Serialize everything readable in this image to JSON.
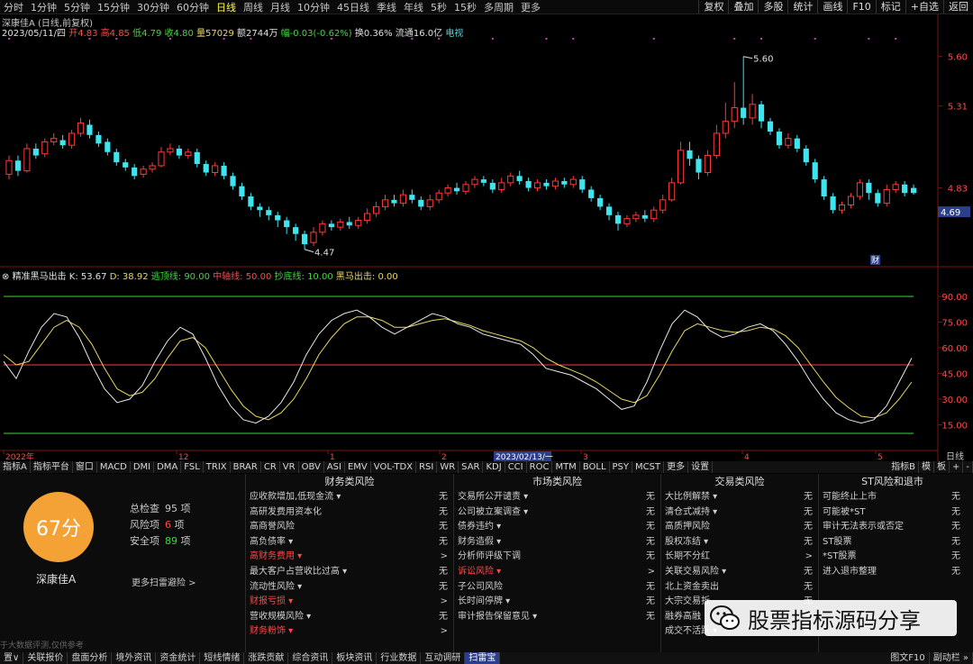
{
  "topbar": {
    "periods": [
      "分时",
      "1分钟",
      "5分钟",
      "15分钟",
      "30分钟",
      "60分钟",
      "日线",
      "周线",
      "月线",
      "10分钟",
      "45日线",
      "季线",
      "年线",
      "5秒",
      "15秒",
      "多周期",
      "更多"
    ],
    "active": "日线",
    "right": [
      "复权",
      "叠加",
      "多股",
      "统计",
      "画线",
      "F10",
      "标记",
      "+自选",
      "返回"
    ]
  },
  "title": "深康佳A (日线,前复权)",
  "info": {
    "date": "2023/05/11/四",
    "open": "开4.83",
    "high": "高4.85",
    "low": "低4.79",
    "close": "收4.80",
    "volume": "量57029",
    "amount": "额2744万",
    "change": "幅-0.03(-0.62%)",
    "turnover": "换0.36%",
    "float": "流通16.0亿",
    "tag": "电视"
  },
  "chart_data": {
    "type": "candlestick+line",
    "main": {
      "price_ticks": [
        "5.60",
        "5.31",
        "4.83",
        "4.69"
      ],
      "ylim": [
        4.4,
        5.72
      ],
      "high_label": "5.60",
      "low_label": "4.47",
      "current_price": "4.69",
      "candles": [
        {
          "o": 4.91,
          "c": 4.99,
          "h": 5.02,
          "l": 4.88
        },
        {
          "o": 4.99,
          "c": 4.93,
          "h": 5.02,
          "l": 4.9
        },
        {
          "o": 4.93,
          "c": 5.06,
          "h": 5.09,
          "l": 4.92
        },
        {
          "o": 5.06,
          "c": 5.02,
          "h": 5.09,
          "l": 5.0
        },
        {
          "o": 5.03,
          "c": 5.1,
          "h": 5.12,
          "l": 5.01
        },
        {
          "o": 5.1,
          "c": 5.12,
          "h": 5.15,
          "l": 5.08
        },
        {
          "o": 5.11,
          "c": 5.08,
          "h": 5.14,
          "l": 5.06
        },
        {
          "o": 5.08,
          "c": 5.15,
          "h": 5.17,
          "l": 5.06
        },
        {
          "o": 5.15,
          "c": 5.21,
          "h": 5.24,
          "l": 5.13
        },
        {
          "o": 5.2,
          "c": 5.14,
          "h": 5.23,
          "l": 5.12
        },
        {
          "o": 5.14,
          "c": 5.09,
          "h": 5.16,
          "l": 5.07
        },
        {
          "o": 5.1,
          "c": 5.04,
          "h": 5.12,
          "l": 5.02
        },
        {
          "o": 5.04,
          "c": 4.98,
          "h": 5.06,
          "l": 4.96
        },
        {
          "o": 4.98,
          "c": 4.95,
          "h": 5.0,
          "l": 4.93
        },
        {
          "o": 4.95,
          "c": 4.9,
          "h": 4.97,
          "l": 4.88
        },
        {
          "o": 4.91,
          "c": 4.94,
          "h": 4.96,
          "l": 4.89
        },
        {
          "o": 4.94,
          "c": 4.96,
          "h": 4.98,
          "l": 4.92
        },
        {
          "o": 4.96,
          "c": 5.04,
          "h": 5.07,
          "l": 4.95
        },
        {
          "o": 5.04,
          "c": 5.06,
          "h": 5.09,
          "l": 5.02
        },
        {
          "o": 5.06,
          "c": 5.02,
          "h": 5.08,
          "l": 5.0
        },
        {
          "o": 5.02,
          "c": 5.04,
          "h": 5.06,
          "l": 5.0
        },
        {
          "o": 5.04,
          "c": 4.97,
          "h": 5.06,
          "l": 4.95
        },
        {
          "o": 4.97,
          "c": 4.92,
          "h": 4.99,
          "l": 4.9
        },
        {
          "o": 4.92,
          "c": 4.96,
          "h": 4.98,
          "l": 4.9
        },
        {
          "o": 4.96,
          "c": 4.9,
          "h": 4.98,
          "l": 4.88
        },
        {
          "o": 4.9,
          "c": 4.84,
          "h": 4.92,
          "l": 4.82
        },
        {
          "o": 4.84,
          "c": 4.78,
          "h": 4.86,
          "l": 4.76
        },
        {
          "o": 4.78,
          "c": 4.72,
          "h": 4.8,
          "l": 4.7
        },
        {
          "o": 4.72,
          "c": 4.7,
          "h": 4.74,
          "l": 4.66
        },
        {
          "o": 4.7,
          "c": 4.67,
          "h": 4.72,
          "l": 4.64
        },
        {
          "o": 4.67,
          "c": 4.64,
          "h": 4.69,
          "l": 4.6
        },
        {
          "o": 4.64,
          "c": 4.6,
          "h": 4.66,
          "l": 4.56
        },
        {
          "o": 4.6,
          "c": 4.56,
          "h": 4.62,
          "l": 4.52
        },
        {
          "o": 4.56,
          "c": 4.5,
          "h": 4.58,
          "l": 4.47
        },
        {
          "o": 4.51,
          "c": 4.57,
          "h": 4.6,
          "l": 4.49
        },
        {
          "o": 4.57,
          "c": 4.62,
          "h": 4.64,
          "l": 4.55
        },
        {
          "o": 4.62,
          "c": 4.6,
          "h": 4.64,
          "l": 4.58
        },
        {
          "o": 4.6,
          "c": 4.63,
          "h": 4.65,
          "l": 4.58
        },
        {
          "o": 4.63,
          "c": 4.61,
          "h": 4.66,
          "l": 4.59
        },
        {
          "o": 4.61,
          "c": 4.64,
          "h": 4.66,
          "l": 4.59
        },
        {
          "o": 4.64,
          "c": 4.68,
          "h": 4.71,
          "l": 4.62
        },
        {
          "o": 4.68,
          "c": 4.72,
          "h": 4.75,
          "l": 4.66
        },
        {
          "o": 4.72,
          "c": 4.76,
          "h": 4.79,
          "l": 4.7
        },
        {
          "o": 4.76,
          "c": 4.74,
          "h": 4.79,
          "l": 4.72
        },
        {
          "o": 4.74,
          "c": 4.79,
          "h": 4.82,
          "l": 4.72
        },
        {
          "o": 4.79,
          "c": 4.76,
          "h": 4.82,
          "l": 4.74
        },
        {
          "o": 4.76,
          "c": 4.72,
          "h": 4.78,
          "l": 4.7
        },
        {
          "o": 4.72,
          "c": 4.76,
          "h": 4.79,
          "l": 4.7
        },
        {
          "o": 4.76,
          "c": 4.8,
          "h": 4.82,
          "l": 4.74
        },
        {
          "o": 4.8,
          "c": 4.83,
          "h": 4.85,
          "l": 4.78
        },
        {
          "o": 4.83,
          "c": 4.81,
          "h": 4.86,
          "l": 4.79
        },
        {
          "o": 4.81,
          "c": 4.85,
          "h": 4.87,
          "l": 4.79
        },
        {
          "o": 4.85,
          "c": 4.88,
          "h": 4.9,
          "l": 4.83
        },
        {
          "o": 4.88,
          "c": 4.86,
          "h": 4.9,
          "l": 4.84
        },
        {
          "o": 4.86,
          "c": 4.82,
          "h": 4.88,
          "l": 4.8
        },
        {
          "o": 4.82,
          "c": 4.86,
          "h": 4.89,
          "l": 4.8
        },
        {
          "o": 4.86,
          "c": 4.9,
          "h": 4.92,
          "l": 4.84
        },
        {
          "o": 4.9,
          "c": 4.87,
          "h": 4.93,
          "l": 4.85
        },
        {
          "o": 4.87,
          "c": 4.83,
          "h": 4.89,
          "l": 4.81
        },
        {
          "o": 4.83,
          "c": 4.86,
          "h": 4.88,
          "l": 4.81
        },
        {
          "o": 4.86,
          "c": 4.84,
          "h": 4.88,
          "l": 4.82
        },
        {
          "o": 4.84,
          "c": 4.87,
          "h": 4.89,
          "l": 4.82
        },
        {
          "o": 4.87,
          "c": 4.85,
          "h": 4.89,
          "l": 4.83
        },
        {
          "o": 4.85,
          "c": 4.88,
          "h": 4.9,
          "l": 4.83
        },
        {
          "o": 4.88,
          "c": 4.82,
          "h": 4.9,
          "l": 4.8
        },
        {
          "o": 4.82,
          "c": 4.77,
          "h": 4.84,
          "l": 4.75
        },
        {
          "o": 4.77,
          "c": 4.72,
          "h": 4.79,
          "l": 4.7
        },
        {
          "o": 4.72,
          "c": 4.67,
          "h": 4.74,
          "l": 4.64
        },
        {
          "o": 4.67,
          "c": 4.62,
          "h": 4.69,
          "l": 4.58
        },
        {
          "o": 4.62,
          "c": 4.65,
          "h": 4.67,
          "l": 4.6
        },
        {
          "o": 4.65,
          "c": 4.67,
          "h": 4.69,
          "l": 4.63
        },
        {
          "o": 4.67,
          "c": 4.65,
          "h": 4.7,
          "l": 4.63
        },
        {
          "o": 4.65,
          "c": 4.7,
          "h": 4.72,
          "l": 4.63
        },
        {
          "o": 4.7,
          "c": 4.76,
          "h": 4.79,
          "l": 4.68
        },
        {
          "o": 4.76,
          "c": 4.86,
          "h": 4.89,
          "l": 4.75
        },
        {
          "o": 4.86,
          "c": 5.05,
          "h": 5.1,
          "l": 4.85
        },
        {
          "o": 5.05,
          "c": 5.0,
          "h": 5.1,
          "l": 4.96
        },
        {
          "o": 5.0,
          "c": 4.92,
          "h": 5.02,
          "l": 4.88
        },
        {
          "o": 4.92,
          "c": 5.02,
          "h": 5.05,
          "l": 4.9
        },
        {
          "o": 5.02,
          "c": 5.15,
          "h": 5.2,
          "l": 5.0
        },
        {
          "o": 5.15,
          "c": 5.22,
          "h": 5.33,
          "l": 5.12
        },
        {
          "o": 5.22,
          "c": 5.3,
          "h": 5.45,
          "l": 5.18
        },
        {
          "o": 5.3,
          "c": 5.24,
          "h": 5.6,
          "l": 5.2
        },
        {
          "o": 5.24,
          "c": 5.32,
          "h": 5.38,
          "l": 5.2
        },
        {
          "o": 5.32,
          "c": 5.22,
          "h": 5.34,
          "l": 5.18
        },
        {
          "o": 5.22,
          "c": 5.16,
          "h": 5.24,
          "l": 5.14
        },
        {
          "o": 5.16,
          "c": 5.08,
          "h": 5.18,
          "l": 5.06
        },
        {
          "o": 5.08,
          "c": 5.12,
          "h": 5.15,
          "l": 5.06
        },
        {
          "o": 5.12,
          "c": 5.06,
          "h": 5.14,
          "l": 5.04
        },
        {
          "o": 5.06,
          "c": 4.98,
          "h": 5.08,
          "l": 4.96
        },
        {
          "o": 4.98,
          "c": 4.88,
          "h": 5.0,
          "l": 4.86
        },
        {
          "o": 4.88,
          "c": 4.78,
          "h": 4.9,
          "l": 4.76
        },
        {
          "o": 4.78,
          "c": 4.7,
          "h": 4.8,
          "l": 4.68
        },
        {
          "o": 4.7,
          "c": 4.73,
          "h": 4.75,
          "l": 4.68
        },
        {
          "o": 4.73,
          "c": 4.78,
          "h": 4.8,
          "l": 4.71
        },
        {
          "o": 4.78,
          "c": 4.86,
          "h": 4.88,
          "l": 4.76
        },
        {
          "o": 4.86,
          "c": 4.8,
          "h": 4.88,
          "l": 4.76
        },
        {
          "o": 4.8,
          "c": 4.74,
          "h": 4.82,
          "l": 4.72
        },
        {
          "o": 4.74,
          "c": 4.82,
          "h": 4.85,
          "l": 4.72
        },
        {
          "o": 4.82,
          "c": 4.85,
          "h": 4.87,
          "l": 4.8
        },
        {
          "o": 4.85,
          "c": 4.8,
          "h": 4.87,
          "l": 4.78
        },
        {
          "o": 4.83,
          "c": 4.8,
          "h": 4.85,
          "l": 4.79
        }
      ]
    },
    "indicator": {
      "name": "精准黑马出击",
      "labels": {
        "k": "K: 53.67",
        "d": "D: 38.92",
        "top": "逃顶线: 90.00",
        "mid": "中轴线: 50.00",
        "bottom": "抄底线: 10.00",
        "signal": "黑马出击: 0.00"
      },
      "ylim": [
        0,
        100
      ],
      "ticks": [
        "90.00",
        "75.00",
        "60.00",
        "45.00",
        "30.00",
        "15.00"
      ],
      "levels": {
        "top": 90,
        "mid": 50,
        "bottom": 10
      },
      "k": [
        52,
        42,
        58,
        72,
        80,
        78,
        66,
        50,
        36,
        28,
        30,
        38,
        52,
        64,
        72,
        68,
        54,
        38,
        26,
        18,
        16,
        20,
        28,
        40,
        56,
        68,
        76,
        80,
        82,
        78,
        72,
        68,
        72,
        76,
        80,
        78,
        74,
        72,
        68,
        66,
        64,
        62,
        56,
        48,
        46,
        44,
        40,
        36,
        30,
        24,
        26,
        40,
        58,
        74,
        82,
        78,
        70,
        66,
        68,
        72,
        74,
        70,
        62,
        52,
        40,
        30,
        22,
        18,
        16,
        18,
        26,
        40,
        54
      ],
      "d": [
        56,
        50,
        52,
        62,
        72,
        76,
        72,
        62,
        48,
        36,
        32,
        34,
        42,
        54,
        64,
        66,
        60,
        48,
        36,
        26,
        20,
        18,
        22,
        30,
        42,
        56,
        66,
        74,
        78,
        78,
        76,
        72,
        72,
        74,
        76,
        77,
        75,
        73,
        70,
        68,
        66,
        64,
        60,
        54,
        50,
        47,
        44,
        40,
        35,
        30,
        28,
        32,
        44,
        58,
        70,
        74,
        72,
        70,
        69,
        70,
        72,
        71,
        67,
        60,
        50,
        40,
        31,
        25,
        20,
        19,
        22,
        30,
        40
      ]
    },
    "x_ticks": [
      "2022年",
      "12",
      "1",
      "2",
      "2023/02/13/一",
      "3",
      "4",
      "5"
    ],
    "right_axis_label": "日线",
    "finance_marker": "财"
  },
  "indicator_tabs": {
    "items": [
      "指标A",
      "指标平台",
      "窗口",
      "MACD",
      "DMI",
      "DMA",
      "FSL",
      "TRIX",
      "BRAR",
      "CR",
      "VR",
      "OBV",
      "ASI",
      "EMV",
      "VOL-TDX",
      "RSI",
      "WR",
      "SAR",
      "KDJ",
      "CCI",
      "ROC",
      "MTM",
      "BOLL",
      "PSY",
      "MCST",
      "更多",
      "设置"
    ],
    "right": [
      "指标B",
      "模",
      "板",
      "+",
      "-"
    ]
  },
  "panel": {
    "score": "67分",
    "stats": [
      {
        "label": "总检查",
        "value": "95",
        "unit": "项"
      },
      {
        "label": "风险项",
        "value": "6",
        "unit": "项"
      },
      {
        "label": "安全项",
        "value": "89",
        "unit": "项"
      }
    ],
    "stock_name": "深康佳A",
    "more": "更多扫雷避险 >",
    "disclaimer": "于大数据评测,仅供参考",
    "columns": [
      {
        "title": "财务类风险",
        "rows": [
          {
            "label": "应收款增加,低现金流 ▾",
            "value": "无",
            "hit": false
          },
          {
            "label": "高研发费用资本化",
            "value": "无",
            "hit": false
          },
          {
            "label": "高商誉风险",
            "value": "无",
            "hit": false
          },
          {
            "label": "高负债率 ▾",
            "value": "无",
            "hit": false
          },
          {
            "label": "高财务费用 ▾",
            "value": ">",
            "hit": true
          },
          {
            "label": "最大客户占营收比过高 ▾",
            "value": "无",
            "hit": false
          },
          {
            "label": "流动性风险 ▾",
            "value": "无",
            "hit": false
          },
          {
            "label": "财报亏损 ▾",
            "value": ">",
            "hit": true
          },
          {
            "label": "营收规模风险 ▾",
            "value": "无",
            "hit": false
          },
          {
            "label": "财务粉饰 ▾",
            "value": ">",
            "hit": true
          }
        ]
      },
      {
        "title": "市场类风险",
        "rows": [
          {
            "label": "交易所公开谴责 ▾",
            "value": "无",
            "hit": false
          },
          {
            "label": "公司被立案调查 ▾",
            "value": "无",
            "hit": false
          },
          {
            "label": "债券违约 ▾",
            "value": "无",
            "hit": false
          },
          {
            "label": "财务造假 ▾",
            "value": "无",
            "hit": false
          },
          {
            "label": "分析师评级下调",
            "value": "无",
            "hit": false
          },
          {
            "label": "诉讼风险 ▾",
            "value": ">",
            "hit": true
          },
          {
            "label": "子公司风险",
            "value": "无",
            "hit": false
          },
          {
            "label": "长时间停牌 ▾",
            "value": "无",
            "hit": false
          },
          {
            "label": "审计报告保留意见 ▾",
            "value": "无",
            "hit": false
          }
        ]
      },
      {
        "title": "交易类风险",
        "rows": [
          {
            "label": "大比例解禁 ▾",
            "value": "无",
            "hit": false
          },
          {
            "label": "清仓式减持 ▾",
            "value": "无",
            "hit": false
          },
          {
            "label": "高质押风险",
            "value": "无",
            "hit": false
          },
          {
            "label": "股权冻结 ▾",
            "value": "无",
            "hit": false
          },
          {
            "label": "长期不分红",
            "value": ">",
            "hit": false
          },
          {
            "label": "关联交易风险 ▾",
            "value": "无",
            "hit": false
          },
          {
            "label": "北上资金卖出",
            "value": "无",
            "hit": false
          },
          {
            "label": "大宗交易折",
            "value": "无",
            "hit": false
          },
          {
            "label": "融券高融",
            "value": "无",
            "hit": false
          },
          {
            "label": "成交不活跃 ▾",
            "value": "无",
            "hit": false
          }
        ]
      },
      {
        "title": "ST风险和退市",
        "rows": [
          {
            "label": "可能终止上市",
            "value": "无",
            "hit": false
          },
          {
            "label": "可能被*ST",
            "value": "无",
            "hit": false
          },
          {
            "label": "审计无法表示或否定",
            "value": "无",
            "hit": false
          },
          {
            "label": "ST股票",
            "value": "无",
            "hit": false
          },
          {
            "label": "*ST股票",
            "value": "无",
            "hit": false
          },
          {
            "label": "进入退市整理",
            "value": "无",
            "hit": false
          }
        ]
      }
    ]
  },
  "watermark": "股票指标源码分享",
  "bottombar": {
    "items": [
      "置∨",
      "关联报价",
      "盘面分析",
      "境外资讯",
      "资金统计",
      "短线情绪",
      "涨跌贡献",
      "综合资讯",
      "板块资讯",
      "行业数据",
      "互动调研",
      "扫雷宝"
    ],
    "active": "扫雷宝",
    "right": [
      "图文F10",
      "副动栏 »"
    ]
  },
  "colors": {
    "up": "#ff3838",
    "down": "#3ee4ee",
    "k_line": "#e8e8e8",
    "d_line": "#e8d860",
    "top": "#3ed83e",
    "mid": "#ff3838",
    "bottom": "#3ed83e",
    "score": "#f4a236"
  }
}
